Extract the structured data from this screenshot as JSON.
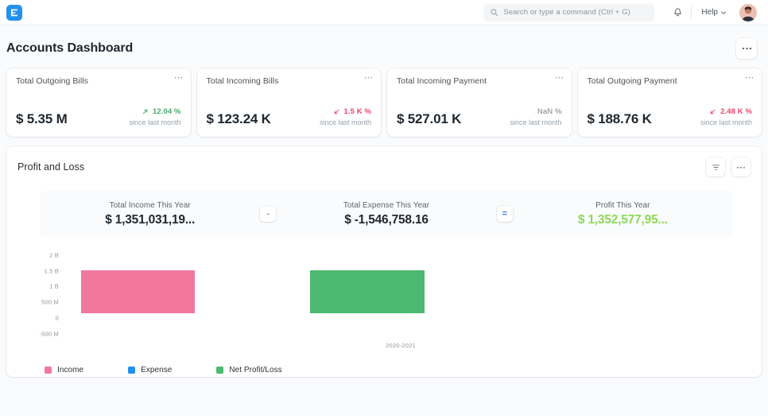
{
  "navbar": {
    "logo_icon": "erpnext-logo-icon",
    "search": {
      "placeholder": "Search or type a command (Ctrl + G)",
      "value": "",
      "icon": "search-icon"
    },
    "notifications_icon": "bell-icon",
    "help_label": "Help",
    "help_caret_icon": "chevron-down-icon",
    "avatar_icon": "user-avatar"
  },
  "page": {
    "title": "Accounts Dashboard",
    "menu_icon": "ellipsis-icon"
  },
  "kpi_cards": [
    {
      "label": "Total Outgoing Bills",
      "value": "$ 5.35 M",
      "delta": "12.04 %",
      "direction": "up",
      "arrow_icon": "arrow-up-right-icon",
      "since": "since last month",
      "menu_icon": "ellipsis-icon"
    },
    {
      "label": "Total Incoming Bills",
      "value": "$ 123.24 K",
      "delta": "1.5 K %",
      "direction": "down",
      "arrow_icon": "arrow-down-left-icon",
      "since": "since last month",
      "menu_icon": "ellipsis-icon"
    },
    {
      "label": "Total Incoming Payment",
      "value": "$ 527.01 K",
      "delta": "NaN %",
      "direction": "flat",
      "arrow_icon": "",
      "since": "since last month",
      "menu_icon": "ellipsis-icon"
    },
    {
      "label": "Total Outgoing Payment",
      "value": "$ 188.76 K",
      "delta": "2.48 K %",
      "direction": "down",
      "arrow_icon": "arrow-down-left-icon",
      "since": "since last month",
      "menu_icon": "ellipsis-icon"
    }
  ],
  "chart_card": {
    "title": "Profit and Loss",
    "filter_icon": "filter-icon",
    "menu_icon": "ellipsis-icon",
    "summary": {
      "income_label": "Total Income This Year",
      "income_value": "$ 1,351,031,19...",
      "minus_operator": "-",
      "expense_label": "Total Expense This Year",
      "expense_value": "$ -1,546,758.16",
      "equals_operator": "=",
      "profit_label": "Profit This Year",
      "profit_value": "$ 1,352,577,95..."
    }
  },
  "colors": {
    "income": "#f2779f",
    "expense": "#2490ef",
    "net_profit_loss": "#4db870",
    "profit_text": "#8ed957",
    "up": "#4ea76f",
    "down": "#f0436d",
    "brand": "#2490ef"
  },
  "chart_data": {
    "type": "bar",
    "title": "Profit and Loss",
    "xlabel": "",
    "ylabel": "",
    "categories": [
      "2020-2021"
    ],
    "tick_labels": [
      "2 B",
      "1.5 B",
      "1 B",
      "500 M",
      "0",
      "-500 M"
    ],
    "tick_values": [
      2000000000,
      1500000000,
      1000000000,
      500000000,
      0,
      -500000000
    ],
    "ylim": [
      -500000000,
      2000000000
    ],
    "grid": false,
    "legend_position": "bottom-left",
    "series": [
      {
        "name": "Income",
        "color": "#f2779f",
        "values": [
          1351031190
        ]
      },
      {
        "name": "Expense",
        "color": "#2490ef",
        "values": [
          -1546758.16
        ]
      },
      {
        "name": "Net Profit/Loss",
        "color": "#4db870",
        "values": [
          1352577950
        ]
      }
    ]
  },
  "legend": [
    {
      "label": "Income",
      "color": "#f2779f"
    },
    {
      "label": "Expense",
      "color": "#2490ef"
    },
    {
      "label": "Net Profit/Loss",
      "color": "#4db870"
    }
  ]
}
